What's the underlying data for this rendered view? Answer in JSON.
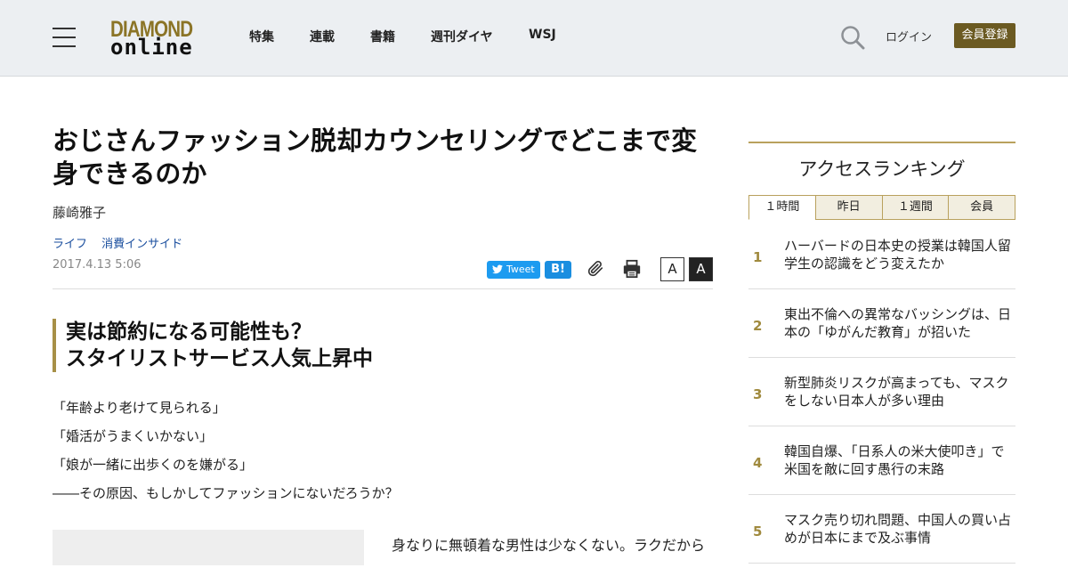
{
  "header": {
    "logo_top": "DIAMOND",
    "logo_bottom": "online",
    "nav": [
      "特集",
      "連載",
      "書籍",
      "週刊ダイヤ",
      "WSJ"
    ],
    "login": "ログイン",
    "register": "会員登録"
  },
  "article": {
    "title": "おじさんファッション脱却カウンセリングでどこまで変身できるのか",
    "author": "藤崎雅子",
    "categories": [
      "ライフ",
      "消費インサイド"
    ],
    "date": "2017.4.13 5:06",
    "share": {
      "tweet": "Tweet",
      "hatena": "B!"
    },
    "font_small": "A",
    "font_large": "A",
    "subhead_line1": "実は節約になる可能性も？",
    "subhead_line2": "スタイリストサービス人気上昇中",
    "body_lines": [
      "「年齢より老けて見られる」",
      "「婚活がうまくいかない」",
      "「娘が一緒に出歩くのを嫌がる」",
      "――その原因、もしかしてファッションにないだろうか？"
    ],
    "lead": "身なりに無頓着な男性は少なくない。ラクだから"
  },
  "ranking": {
    "title": "アクセスランキング",
    "tabs": [
      "１時間",
      "昨日",
      "１週間",
      "会員"
    ],
    "active_tab": 0,
    "items": [
      {
        "rank": "1",
        "text": "ハーバードの日本史の授業は韓国人留学生の認識をどう変えたか"
      },
      {
        "rank": "2",
        "text": "東出不倫への異常なバッシングは、日本の「ゆがんだ教育」が招いた"
      },
      {
        "rank": "3",
        "text": "新型肺炎リスクが高まっても、マスクをしない日本人が多い理由"
      },
      {
        "rank": "4",
        "text": "韓国自爆、「日系人の米大使叩き」で米国を敵に回す愚行の末路"
      },
      {
        "rank": "5",
        "text": "マスク売り切れ問題、中国人の買い占めが日本にまで及ぶ事情"
      }
    ]
  },
  "colors": {
    "brand_gold": "#8b7426",
    "register_bg": "#6b5a22",
    "tweet_blue": "#1d9bf0",
    "hatena_blue": "#1a8ee0"
  }
}
